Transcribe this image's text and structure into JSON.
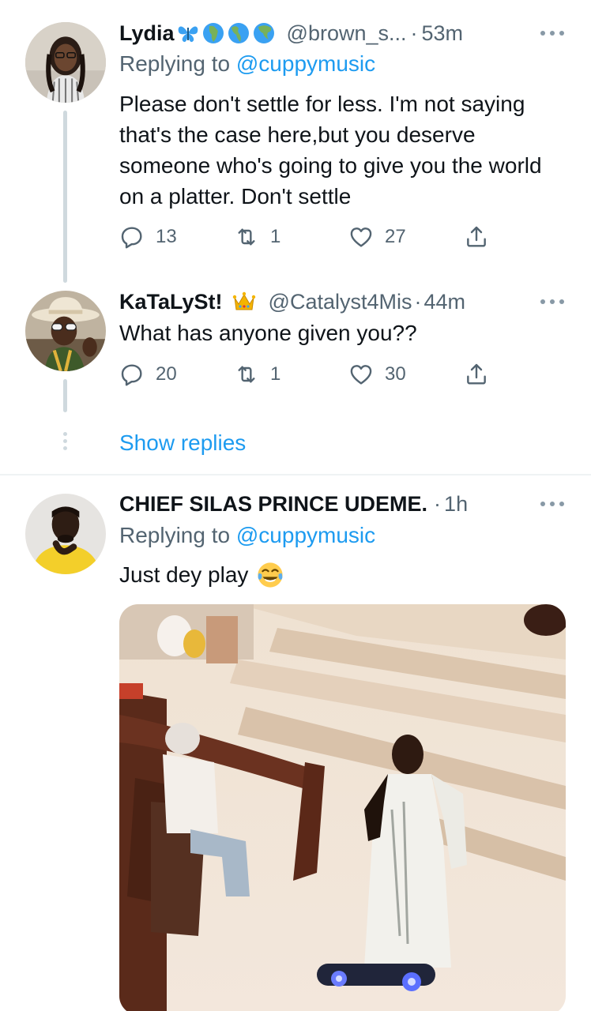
{
  "tweets": [
    {
      "name": "Lydia",
      "name_emojis": [
        "butterfly-emoji",
        "globe-africa-emoji",
        "globe-americas-emoji",
        "globe-asia-emoji"
      ],
      "handle": "@brown_s...",
      "separator": "·",
      "time": "53m",
      "replying_prefix": "Replying to ",
      "replying_mention": "@cuppymusic",
      "text": "Please don't settle for less. I'm not saying that's the case here,but you deserve someone who's going to give you the world on a platter. Don't settle",
      "replies": "13",
      "retweets": "1",
      "likes": "27"
    },
    {
      "name": "KaTaLySt!",
      "name_emojis": [
        "crown-emoji"
      ],
      "handle": "@Catalyst4Mis",
      "separator": "·",
      "time": "44m",
      "text": "What has anyone given you??",
      "replies": "20",
      "retweets": "1",
      "likes": "30"
    },
    {
      "name": "CHIEF SILAS PRINCE UDEME.",
      "separator": "·",
      "time": "1h",
      "replying_prefix": "Replying to ",
      "replying_mention": "@cuppymusic",
      "text": "Just dey play",
      "text_emoji": "tears-of-joy-emoji"
    }
  ],
  "show_replies": "Show replies",
  "colors": {
    "link": "#1d9bf0",
    "secondary": "#536471",
    "thread_line": "#cfd9de",
    "divider": "#eff3f4"
  }
}
